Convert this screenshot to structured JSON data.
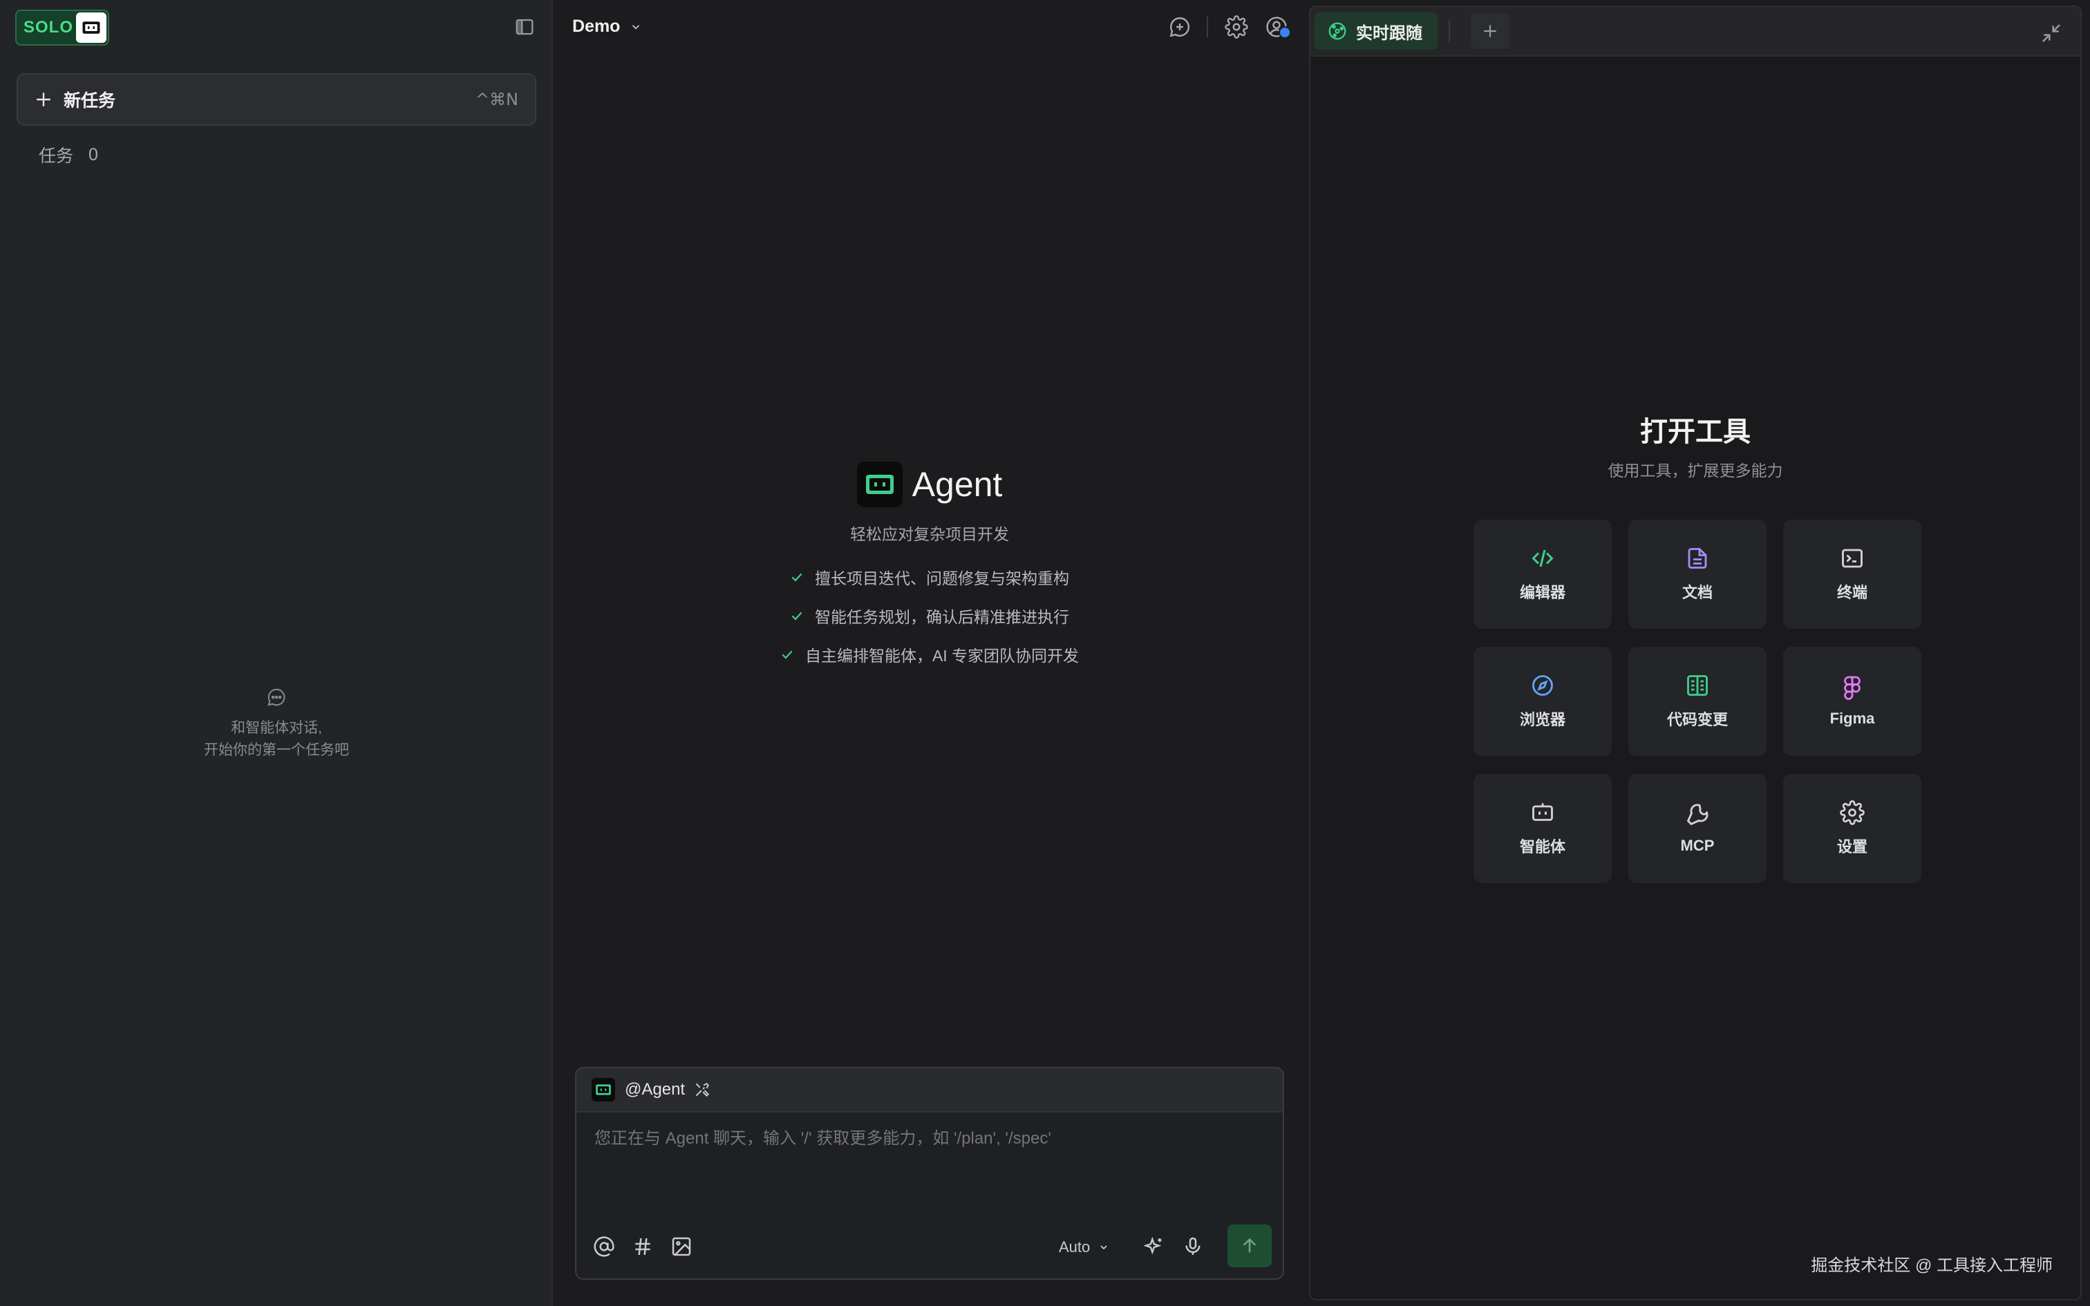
{
  "sidebar": {
    "logo_text": "SOLO",
    "new_task_label": "新任务",
    "new_task_shortcut": "^⌘N",
    "tasks_label": "任务",
    "tasks_count": "0",
    "empty_line1": "和智能体对话,",
    "empty_line2": "开始你的第一个任务吧"
  },
  "main": {
    "project_title": "Demo",
    "hero_name": "Agent",
    "hero_subtitle": "轻松应对复杂项目开发",
    "features": [
      "擅长项目迭代、问题修复与架构重构",
      "智能任务规划，确认后精准推进执行",
      "自主编排智能体，AI 专家团队协同开发"
    ],
    "composer": {
      "agent_mention": "@Agent",
      "placeholder": "您正在与 Agent 聊天，输入 '/' 获取更多能力，如 '/plan', '/spec'",
      "mode": "Auto"
    }
  },
  "panel": {
    "tab_live": "实时跟随",
    "title": "打开工具",
    "subtitle": "使用工具，扩展更多能力",
    "tools": [
      {
        "label": "编辑器",
        "icon": "code-icon",
        "color": "#3ecf8e"
      },
      {
        "label": "文档",
        "icon": "document-icon",
        "color": "#a78bfa"
      },
      {
        "label": "终端",
        "icon": "terminal-icon",
        "color": "#d4d4d8"
      },
      {
        "label": "浏览器",
        "icon": "compass-icon",
        "color": "#60a5fa"
      },
      {
        "label": "代码变更",
        "icon": "diff-icon",
        "color": "#3ecf8e"
      },
      {
        "label": "Figma",
        "icon": "figma-icon",
        "color": "#e879f9"
      },
      {
        "label": "智能体",
        "icon": "agent-icon",
        "color": "#d4d4d8"
      },
      {
        "label": "MCP",
        "icon": "wrench-icon",
        "color": "#d4d4d8"
      },
      {
        "label": "设置",
        "icon": "gear-icon",
        "color": "#d4d4d8"
      }
    ],
    "watermark": "掘金技术社区 @ 工具接入工程师"
  },
  "colors": {
    "accent": "#3ecf8e",
    "sidebar_bg": "#232427",
    "main_bg": "#1c1c1f",
    "send_bg": "#1f4d34"
  }
}
